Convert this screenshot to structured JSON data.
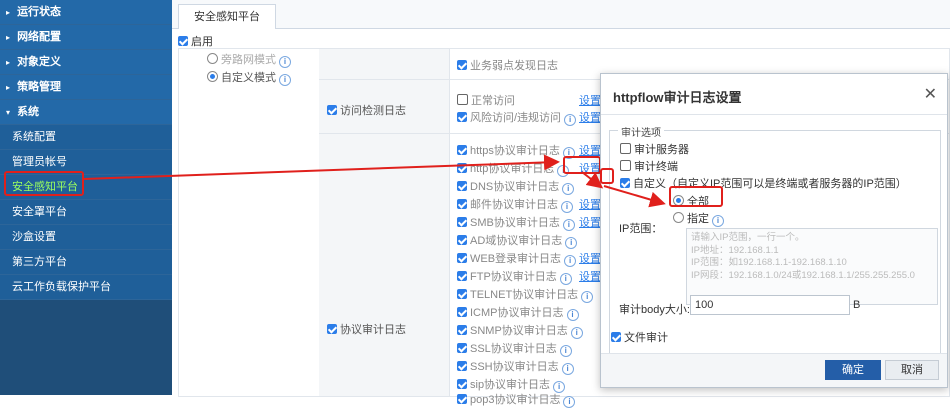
{
  "sidebar": {
    "items": [
      {
        "label": "运行状态",
        "type": "section"
      },
      {
        "label": "网络配置",
        "type": "section"
      },
      {
        "label": "对象定义",
        "type": "section"
      },
      {
        "label": "策略管理",
        "type": "section"
      },
      {
        "label": "系统",
        "type": "section"
      },
      {
        "label": "系统配置",
        "type": "sub"
      },
      {
        "label": "管理员帐号",
        "type": "sub"
      },
      {
        "label": "安全感知平台",
        "type": "sub",
        "active": true
      },
      {
        "label": "安全罩平台",
        "type": "sub"
      },
      {
        "label": "沙盒设置",
        "type": "sub"
      },
      {
        "label": "第三方平台",
        "type": "sub"
      },
      {
        "label": "云工作负载保护平台",
        "type": "sub"
      }
    ]
  },
  "tabs": {
    "active": "安全感知平台"
  },
  "enable": {
    "label": "启用"
  },
  "modes": {
    "bypass": "旁路网模式",
    "custom": "自定义模式"
  },
  "log_rows": {
    "vuln_log": "业务弱点发现日志",
    "access_label": "访问检测日志",
    "normal_access": "正常访问",
    "risk_access": "风险访问/违规访问",
    "proto_label": "协议审计日志",
    "set": "设置",
    "protocols": [
      "https协议审计日志",
      "http协议审计日志",
      "DNS协议审计日志",
      "邮件协议审计日志",
      "SMB协议审计日志",
      "AD域协议审计日志",
      "WEB登录审计日志",
      "FTP协议审计日志",
      "TELNET协议审计日志",
      "ICMP协议审计日志",
      "SNMP协议审计日志",
      "SSL协议审计日志",
      "SSH协议审计日志",
      "sip协议审计日志",
      "pop3协议审计日志"
    ]
  },
  "dialog": {
    "title": "httpflow审计日志设置",
    "legend": "审计选项",
    "audit_server": "审计服务器",
    "audit_terminal": "审计终端",
    "custom": "自定义（自定义IP范围可以是终端或者服务器的IP范围）",
    "ip_range_label": "IP范围：",
    "all": "全部",
    "specify": "指定",
    "textarea_placeholder": "请输入IP范围，一行一个。\nIP地址：192.168.1.1\nIP范围：如192.168.1.1-192.168.1.10\nIP网段：192.168.1.0/24或192.168.1.1/255.255.255.0",
    "body_size_label": "审计body大小:",
    "body_size_value": "100",
    "body_unit": "B",
    "file_audit": "文件审计",
    "ok": "确定",
    "cancel": "取消"
  },
  "colors": {
    "sidebar": "#1f4e79",
    "accent": "#2b7de9",
    "highlight": "#e0201c",
    "ok_button": "#245ea8"
  }
}
